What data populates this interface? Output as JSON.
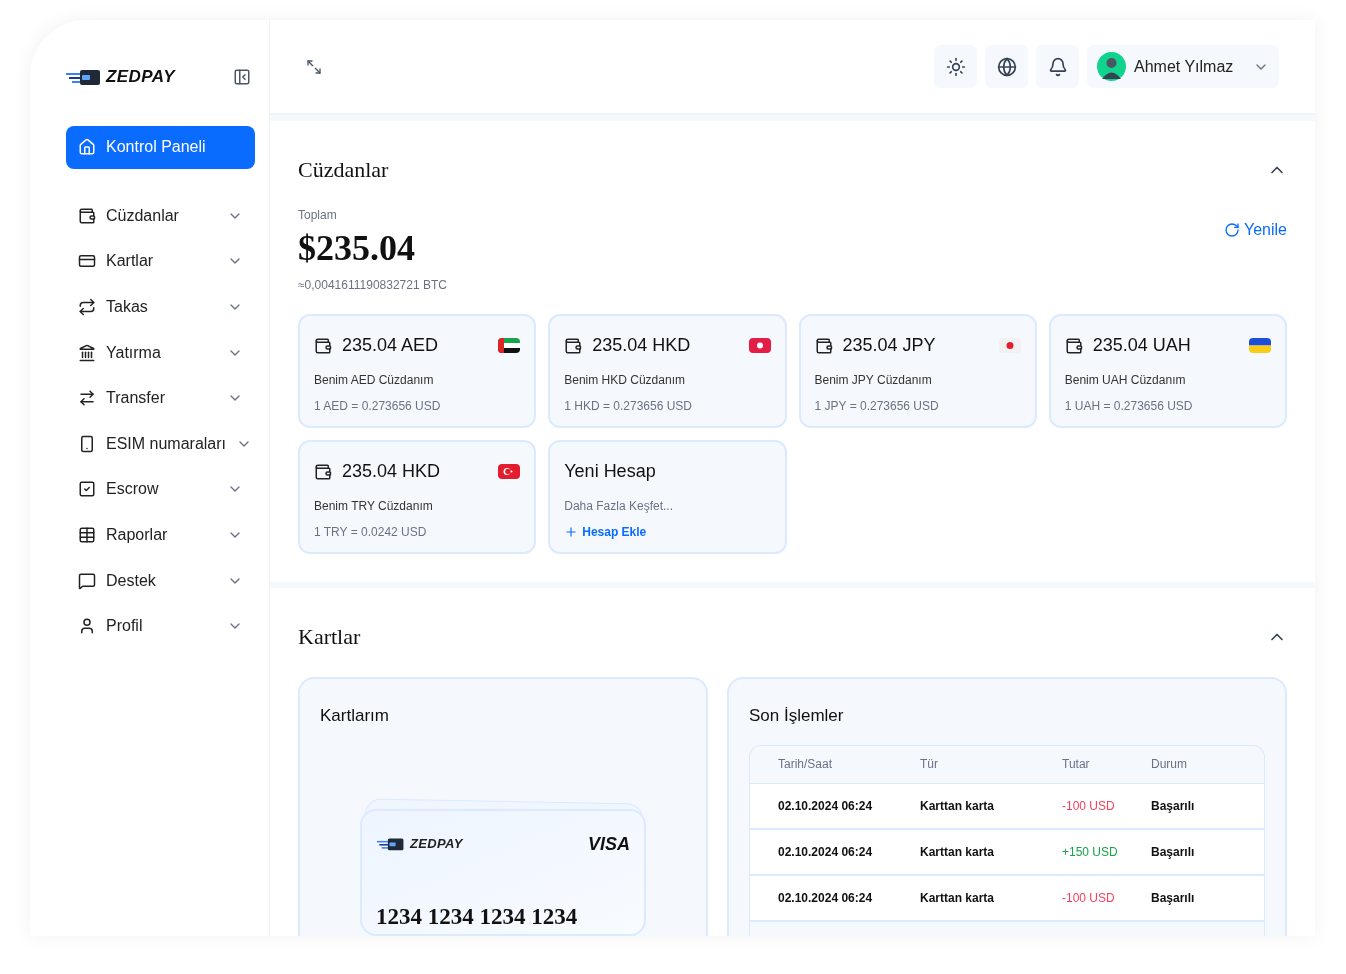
{
  "brand": {
    "name": "ZEDPAY"
  },
  "sidebar": {
    "items": [
      {
        "label": "Kontrol Paneli",
        "selected": true,
        "has_submenu": false
      },
      {
        "label": "Cüzdanlar",
        "selected": false,
        "has_submenu": true
      },
      {
        "label": "Kartlar",
        "selected": false,
        "has_submenu": true
      },
      {
        "label": "Takas",
        "selected": false,
        "has_submenu": true
      },
      {
        "label": "Yatırma",
        "selected": false,
        "has_submenu": true
      },
      {
        "label": "Transfer",
        "selected": false,
        "has_submenu": true
      },
      {
        "label": "ESIM numaraları",
        "selected": false,
        "has_submenu": true
      },
      {
        "label": "Escrow",
        "selected": false,
        "has_submenu": true
      },
      {
        "label": "Raporlar",
        "selected": false,
        "has_submenu": true
      },
      {
        "label": "Destek",
        "selected": false,
        "has_submenu": true
      },
      {
        "label": "Profil",
        "selected": false,
        "has_submenu": true
      }
    ]
  },
  "header": {
    "user": {
      "name": "Ahmet Yılmaz"
    }
  },
  "wallets": {
    "title": "Cüzdanlar",
    "total_label": "Toplam",
    "total": "$235.04",
    "btc": "≈0,0041611190832721 BTC",
    "refresh": "Yenile",
    "items": [
      {
        "amount": "235.04 AED",
        "name": "Benim AED Cüzdanım",
        "rate": "1 AED = 0.273656 USD"
      },
      {
        "amount": "235.04 HKD",
        "name": "Benim HKD Cüzdanım",
        "rate": "1 HKD = 0.273656 USD"
      },
      {
        "amount": "235.04 JPY",
        "name": "Benim JPY Cüzdanım",
        "rate": "1 JPY = 0.273656 USD"
      },
      {
        "amount": "235.04 UAH",
        "name": "Benim UAH Cüzdanım",
        "rate": "1 UAH = 0.273656 USD"
      },
      {
        "amount": "235.04 HKD",
        "name": "Benim TRY Cüzdanım",
        "rate": "1 TRY = 0.0242 USD"
      }
    ],
    "new_account": {
      "title": "Yeni Hesap",
      "subtitle": "Daha Fazla Keşfet...",
      "action": "Hesap Ekle"
    }
  },
  "cards": {
    "title": "Kartlar",
    "my_cards": {
      "title": "Kartlarım",
      "card": {
        "brand": "ZEDPAY",
        "network": "VISA",
        "number": "1234 1234 1234 1234"
      }
    },
    "transactions": {
      "title": "Son İşlemler",
      "columns": [
        "Tarih/Saat",
        "Tür",
        "Tutar",
        "Durum"
      ],
      "rows": [
        {
          "date": "02.10.2024 06:24",
          "type": "Karttan karta",
          "amount": "-100 USD",
          "color": "#f43f5e",
          "status": "Başarılı"
        },
        {
          "date": "02.10.2024 06:24",
          "type": "Karttan karta",
          "amount": "+150 USD",
          "color": "#16a34a",
          "status": "Başarılı"
        },
        {
          "date": "02.10.2024 06:24",
          "type": "Karttan karta",
          "amount": "-100 USD",
          "color": "#f43f5e",
          "status": "Başarılı"
        }
      ]
    }
  }
}
